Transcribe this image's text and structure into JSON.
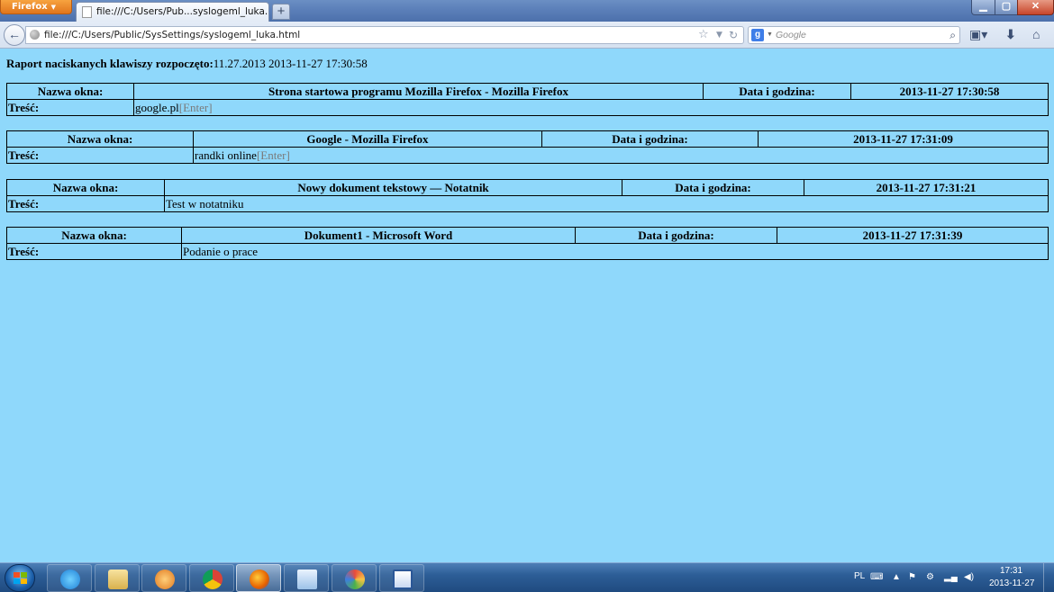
{
  "browser": {
    "menu_button": "Firefox",
    "tab_title": "file:///C:/Users/Pub...syslogeml_luka.html",
    "url": "file:///C:/Users/Public/SysSettings/syslogeml_luka.html",
    "search_placeholder": "Google",
    "search_engine_letter": "g",
    "icons": {
      "back": "back-arrow-icon",
      "page": "globe-icon",
      "bookmark": "star-icon",
      "reload": "reload-icon",
      "search": "magnifier-icon",
      "bookmarks_menu": "bookmarks-icon",
      "downloads": "download-arrow-icon",
      "home": "home-icon"
    }
  },
  "report": {
    "header_label": "Raport naciskanych klawiszy rozpoczęto:",
    "header_value": "11.27.2013 2013-11-27 17:30:58",
    "window_label": "Nazwa okna:",
    "datetime_label": "Data i godzina:",
    "content_label": "Treść:",
    "entries": [
      {
        "window": "Strona startowa programu Mozilla Firefox - Mozilla Firefox",
        "datetime": "2013-11-27 17:30:58",
        "text": "google.pl",
        "key": "[Enter]"
      },
      {
        "window": "Google - Mozilla Firefox",
        "datetime": "2013-11-27 17:31:09",
        "text": "randki online",
        "key": "[Enter]"
      },
      {
        "window": "Nowy dokument tekstowy — Notatnik",
        "datetime": "2013-11-27 17:31:21",
        "text": "Test w notatniku",
        "key": ""
      },
      {
        "window": "Dokument1 - Microsoft Word",
        "datetime": "2013-11-27 17:31:39",
        "text": "Podanie o prace",
        "key": ""
      }
    ]
  },
  "taskbar": {
    "apps": [
      "internet-explorer-icon",
      "file-explorer-icon",
      "media-player-icon",
      "chrome-icon",
      "firefox-icon",
      "notepad-icon",
      "paint-icon",
      "word-icon"
    ],
    "language": "PL",
    "time": "17:31",
    "date": "2013-11-27"
  },
  "colors": {
    "page_background": "#8fd8fb",
    "key_text": "#7a7a7a"
  }
}
